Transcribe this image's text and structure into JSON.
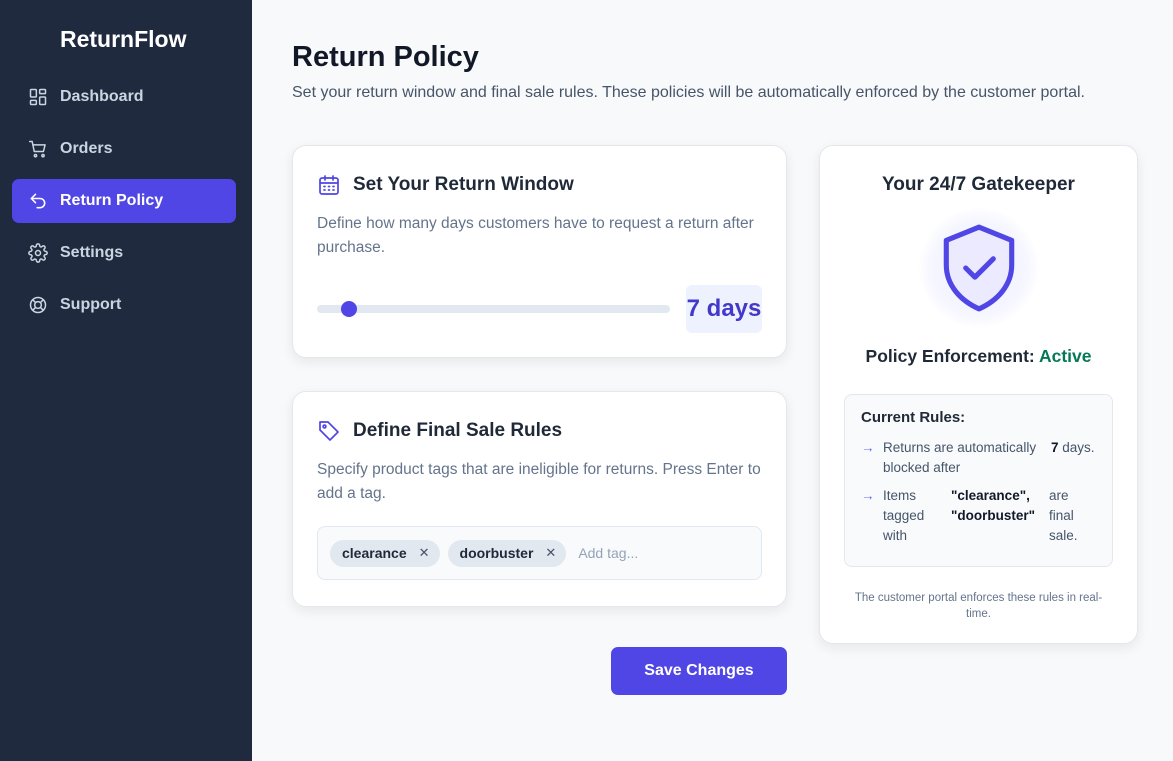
{
  "app": {
    "name": "ReturnFlow"
  },
  "sidebar": {
    "items": [
      {
        "label": "Dashboard",
        "icon": "dashboard-icon",
        "active": false
      },
      {
        "label": "Orders",
        "icon": "cart-icon",
        "active": false
      },
      {
        "label": "Return Policy",
        "icon": "return-arrow-icon",
        "active": true
      },
      {
        "label": "Settings",
        "icon": "gear-icon",
        "active": false
      },
      {
        "label": "Support",
        "icon": "lifebuoy-icon",
        "active": false
      }
    ]
  },
  "header": {
    "title": "Return Policy",
    "subtitle": "Set your return window and final sale rules. These policies will be automatically enforced by the customer portal."
  },
  "return_window": {
    "title": "Set Your Return Window",
    "description": "Define how many days customers have to request a return after purchase.",
    "days": 7,
    "days_label": "7 days",
    "slider_min": 0,
    "slider_max": 77
  },
  "final_sale": {
    "title": "Define Final Sale Rules",
    "description": "Specify product tags that are ineligible for returns. Press Enter to add a tag.",
    "tags": [
      "clearance",
      "doorbuster"
    ],
    "placeholder": "Add tag..."
  },
  "gatekeeper": {
    "title": "Your 24/7 Gatekeeper",
    "status_label": "Policy Enforcement:",
    "status_value": "Active",
    "rules_title": "Current Rules:",
    "rule1_text": "Returns are automatically blocked after",
    "rule1_value": "7",
    "rule1_suffix": "days.",
    "rule2_prefix": "Items tagged with",
    "rule2_tags": "\"clearance\", \"doorbuster\"",
    "rule2_suffix": "are final sale.",
    "footer": "The customer portal enforces these rules in real-time."
  },
  "actions": {
    "save_label": "Save Changes"
  },
  "colors": {
    "accent": "#4f46e5",
    "sidebar_bg": "#1f2a3f",
    "active_status": "#047857"
  }
}
